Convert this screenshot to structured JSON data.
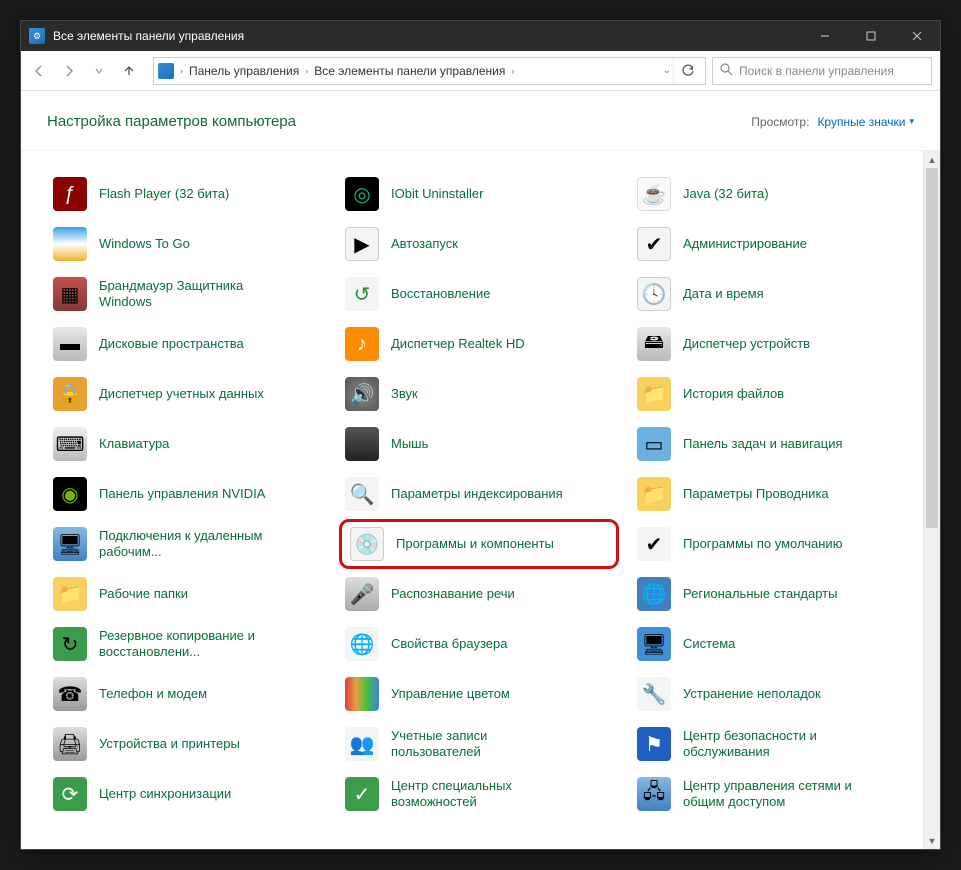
{
  "window": {
    "title": "Все элементы панели управления"
  },
  "breadcrumb": {
    "seg1": "Панель управления",
    "seg2": "Все элементы панели управления"
  },
  "search": {
    "placeholder": "Поиск в панели управления"
  },
  "header": {
    "title": "Настройка параметров компьютера"
  },
  "view": {
    "label": "Просмотр:",
    "value": "Крупные значки"
  },
  "items": [
    {
      "label": "Flash Player (32 бита)",
      "icon": "ic-flash",
      "glyph": "ƒ"
    },
    {
      "label": "IObit Uninstaller",
      "icon": "ic-iobit",
      "glyph": "◎"
    },
    {
      "label": "Java (32 бита)",
      "icon": "ic-java",
      "glyph": "☕"
    },
    {
      "label": "Windows To Go",
      "icon": "ic-wtg",
      "glyph": ""
    },
    {
      "label": "Автозапуск",
      "icon": "ic-auto",
      "glyph": "▶"
    },
    {
      "label": "Администрирование",
      "icon": "ic-admin",
      "glyph": "✔"
    },
    {
      "label": "Брандмауэр Защитника Windows",
      "icon": "ic-fw",
      "glyph": "▦"
    },
    {
      "label": "Восстановление",
      "icon": "ic-restore",
      "glyph": "↺"
    },
    {
      "label": "Дата и время",
      "icon": "ic-date",
      "glyph": "🕓"
    },
    {
      "label": "Дисковые пространства",
      "icon": "ic-disk",
      "glyph": "▬"
    },
    {
      "label": "Диспетчер Realtek HD",
      "icon": "ic-realtek",
      "glyph": "♪"
    },
    {
      "label": "Диспетчер устройств",
      "icon": "ic-devmgr",
      "glyph": "🖴"
    },
    {
      "label": "Диспетчер учетных данных",
      "icon": "ic-cred",
      "glyph": "🔒"
    },
    {
      "label": "Звук",
      "icon": "ic-sound",
      "glyph": "🔊"
    },
    {
      "label": "История файлов",
      "icon": "ic-filehist",
      "glyph": "📁"
    },
    {
      "label": "Клавиатура",
      "icon": "ic-kbd",
      "glyph": "⌨"
    },
    {
      "label": "Мышь",
      "icon": "ic-mouse",
      "glyph": ""
    },
    {
      "label": "Панель задач и навигация",
      "icon": "ic-taskbar",
      "glyph": "▭"
    },
    {
      "label": "Панель управления NVIDIA",
      "icon": "ic-nvidia",
      "glyph": "◉"
    },
    {
      "label": "Параметры индексирования",
      "icon": "ic-index",
      "glyph": "🔍"
    },
    {
      "label": "Параметры Проводника",
      "icon": "ic-explorer",
      "glyph": "📁"
    },
    {
      "label": "Подключения к удаленным рабочим...",
      "icon": "ic-rdp",
      "glyph": "🖥"
    },
    {
      "label": "Программы и компоненты",
      "icon": "ic-prog",
      "glyph": "💿",
      "highlight": true
    },
    {
      "label": "Программы по умолчанию",
      "icon": "ic-defprog",
      "glyph": "✔"
    },
    {
      "label": "Рабочие папки",
      "icon": "ic-folders",
      "glyph": "📁"
    },
    {
      "label": "Распознавание речи",
      "icon": "ic-speech",
      "glyph": "🎤"
    },
    {
      "label": "Региональные стандарты",
      "icon": "ic-region",
      "glyph": "🌐"
    },
    {
      "label": "Резервное копирование и восстановлени...",
      "icon": "ic-backup",
      "glyph": "↻"
    },
    {
      "label": "Свойства браузера",
      "icon": "ic-inet",
      "glyph": "🌐"
    },
    {
      "label": "Система",
      "icon": "ic-system",
      "glyph": "🖥"
    },
    {
      "label": "Телефон и модем",
      "icon": "ic-phone",
      "glyph": "☎"
    },
    {
      "label": "Управление цветом",
      "icon": "ic-color",
      "glyph": ""
    },
    {
      "label": "Устранение неполадок",
      "icon": "ic-trouble",
      "glyph": "🔧"
    },
    {
      "label": "Устройства и принтеры",
      "icon": "ic-devprint",
      "glyph": "🖨"
    },
    {
      "label": "Учетные записи пользователей",
      "icon": "ic-users",
      "glyph": "👥"
    },
    {
      "label": "Центр безопасности и обслуживания",
      "icon": "ic-security",
      "glyph": "⚑"
    },
    {
      "label": "Центр синхронизации",
      "icon": "ic-sync",
      "glyph": "⟳"
    },
    {
      "label": "Центр специальных возможностей",
      "icon": "ic-access",
      "glyph": "✓"
    },
    {
      "label": "Центр управления сетями и общим доступом",
      "icon": "ic-netshare",
      "glyph": "🖧"
    }
  ]
}
